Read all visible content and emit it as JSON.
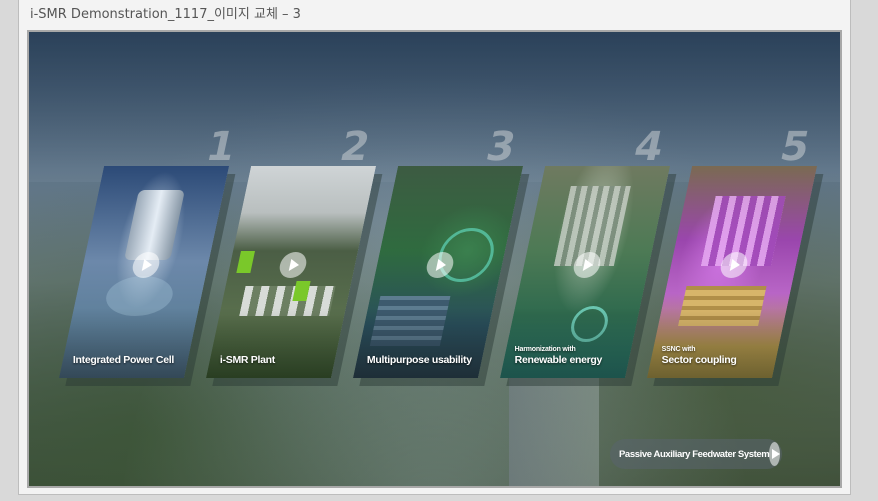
{
  "window": {
    "title": "i-SMR Demonstration_1117_이미지 교체 – 3"
  },
  "cards": [
    {
      "number": "1",
      "label": "Integrated Power Cell",
      "sublabel": ""
    },
    {
      "number": "2",
      "label": "i-SMR Plant",
      "sublabel": ""
    },
    {
      "number": "3",
      "label": "Multipurpose usability",
      "sublabel": ""
    },
    {
      "number": "4",
      "label": "Renewable energy",
      "sublabel": "Harmonization with"
    },
    {
      "number": "5",
      "label": "Sector coupling",
      "sublabel": "SSNC with"
    }
  ],
  "bottom_button": {
    "label": "Passive Auxiliary Feedwater System"
  },
  "icons": {
    "play": "play-icon"
  }
}
